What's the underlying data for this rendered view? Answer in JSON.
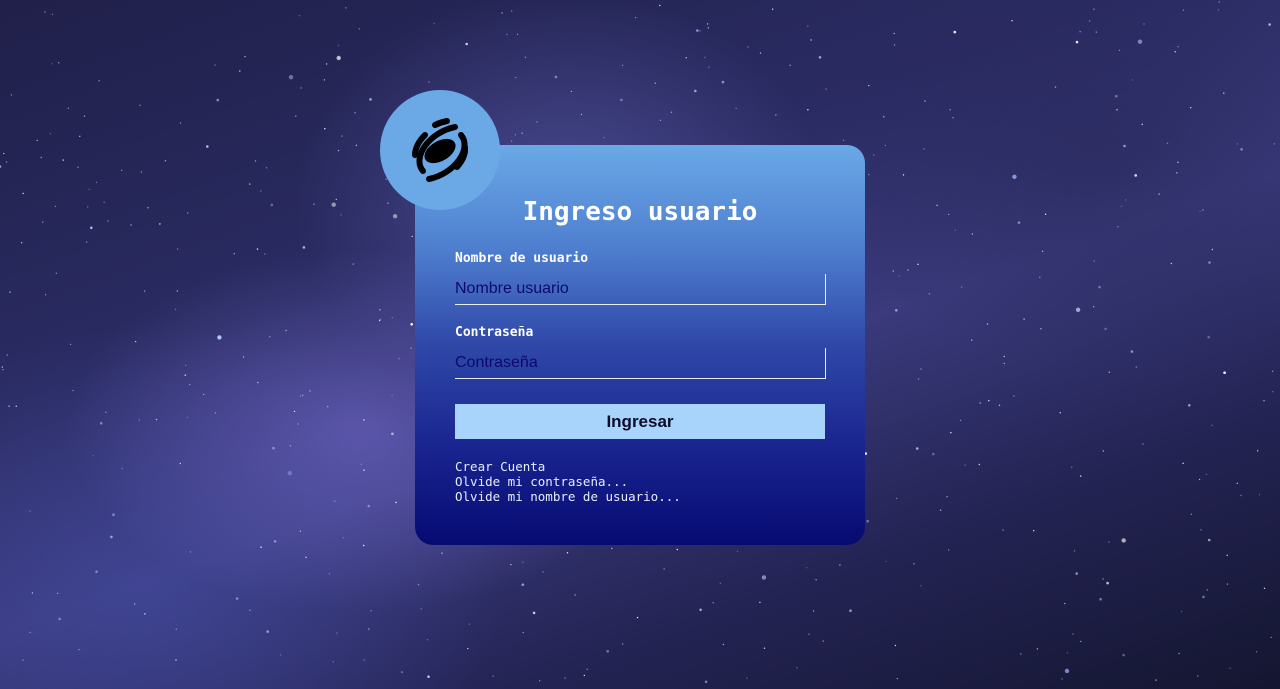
{
  "login": {
    "title": "Ingreso usuario",
    "username": {
      "label": "Nombre de usuario",
      "placeholder": "Nombre usuario",
      "value": ""
    },
    "password": {
      "label": "Contraseña",
      "placeholder": "Contraseña",
      "value": ""
    },
    "submit_label": "Ingresar",
    "links": {
      "create_account": "Crear Cuenta",
      "forgot_password": "Olvide mi contraseña...",
      "forgot_username": "Olvide mi nombre de usuario..."
    }
  },
  "logo": {
    "icon": "galaxy-icon"
  },
  "colors": {
    "card_top": "#6aa9e6",
    "card_bottom": "#060a72",
    "logo_circle": "#6aa9e6",
    "button_bg": "#a8d4fb",
    "input_text": "#0a0a6e"
  }
}
